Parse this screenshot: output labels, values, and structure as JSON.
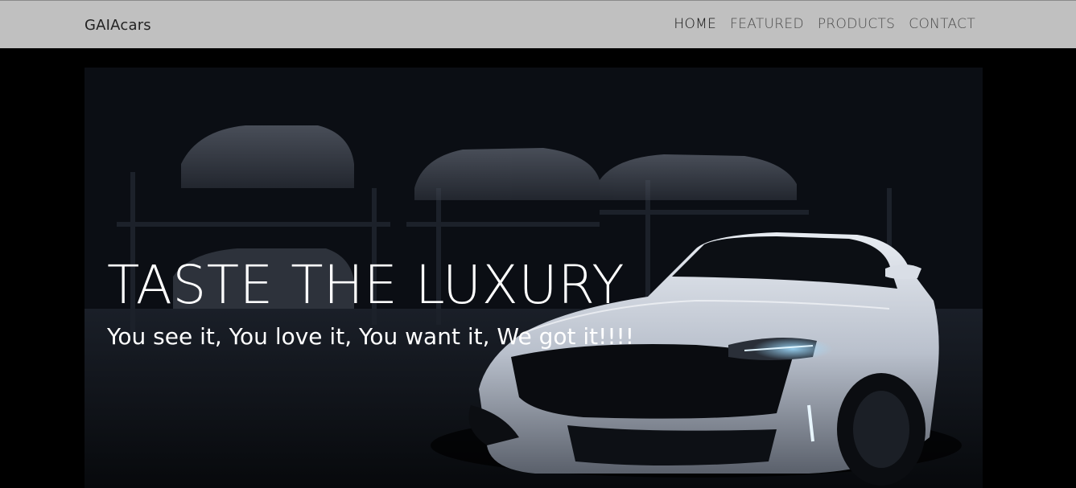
{
  "header": {
    "brand": "GAIAcars",
    "nav": [
      {
        "label": "HOME",
        "active": true
      },
      {
        "label": "FEATURED",
        "active": false
      },
      {
        "label": "PRODUCTS",
        "active": false
      },
      {
        "label": "CONTACT",
        "active": false
      }
    ]
  },
  "hero": {
    "title": "TASTE THE LUXURY",
    "subtitle": "You see it, You love it, You want it, We got it!!!!",
    "image_icon": "sports-car-garage-image"
  },
  "colors": {
    "header_bg": "#c0c0c0",
    "page_bg": "#000000",
    "hero_text": "#ffffff"
  }
}
